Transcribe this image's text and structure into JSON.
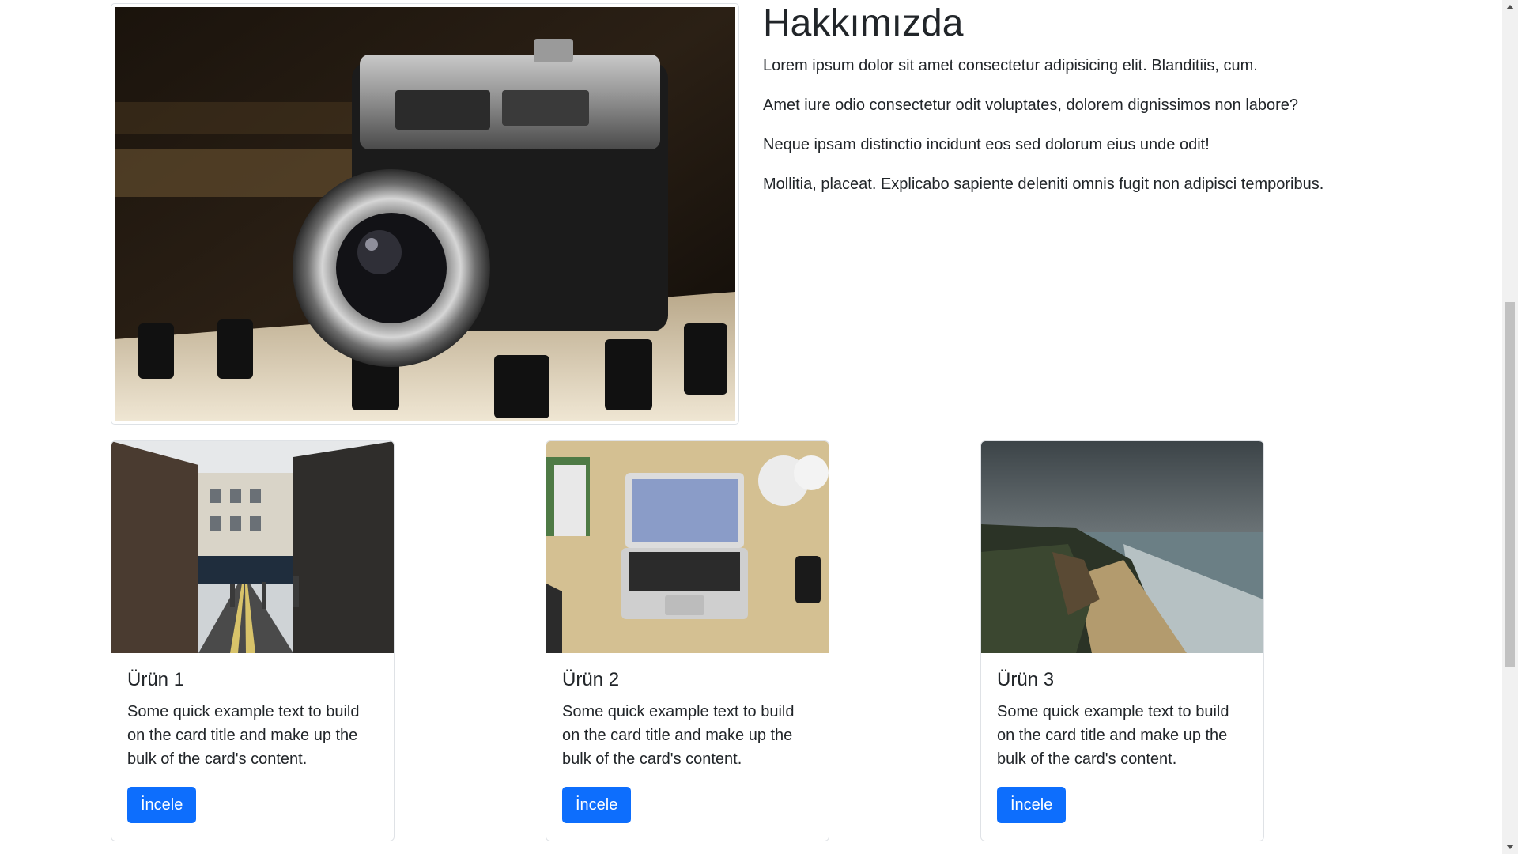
{
  "about": {
    "title": "Hakkımızda",
    "paragraphs": [
      "Lorem ipsum dolor sit amet consectetur adipisicing elit. Blanditiis, cum.",
      "Amet iure odio consectetur odit voluptates, dolorem dignissimos non labore?",
      "Neque ipsam distinctio incidunt eos sed dolorum eius unde odit!",
      "Mollitia, placeat. Explicabo sapiente deleniti omnis fugit non adipisci temporibus."
    ]
  },
  "products": [
    {
      "title": "Ürün 1",
      "text": "Some quick example text to build on the card title and make up the bulk of the card's content.",
      "button": "İncele"
    },
    {
      "title": "Ürün 2",
      "text": "Some quick example text to build on the card title and make up the bulk of the card's content.",
      "button": "İncele"
    },
    {
      "title": "Ürün 3",
      "text": "Some quick example text to build on the card title and make up the bulk of the card's content.",
      "button": "İncele"
    }
  ],
  "colors": {
    "primary_button": "#0d6efd",
    "text": "#212529",
    "border": "#dee2e6"
  }
}
